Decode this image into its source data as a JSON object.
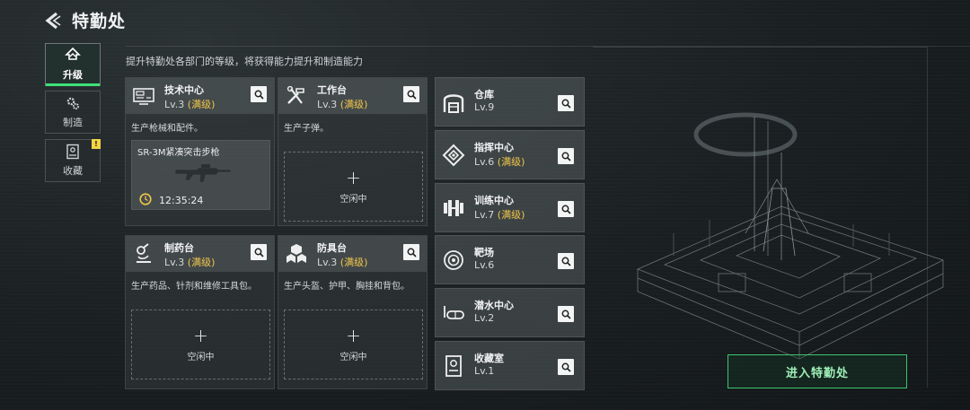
{
  "header": {
    "title": "特勤处"
  },
  "subtitle": "提升特勤处各部门的等级，将获得能力提升和制造能力",
  "sidebar": {
    "tabs": [
      {
        "label": "升级",
        "icon": "upgrade-icon",
        "active": true
      },
      {
        "label": "制造",
        "icon": "gear-icon",
        "active": false
      },
      {
        "label": "收藏",
        "icon": "collection-icon",
        "active": false,
        "badge": "!"
      }
    ]
  },
  "production_cards": [
    {
      "name": "技术中心",
      "level": "Lv.3",
      "max": "(满级)",
      "icon": "computer-icon",
      "desc": "生产枪械和配件。",
      "slot": {
        "status": "producing",
        "item": "SR-3M紧凑突击步枪",
        "time": "12:35:24"
      }
    },
    {
      "name": "工作台",
      "level": "Lv.3",
      "max": "(满级)",
      "icon": "tools-icon",
      "desc": "生产子弹。",
      "slot": {
        "status": "idle",
        "label": "空闲中"
      }
    },
    {
      "name": "制药台",
      "level": "Lv.3",
      "max": "(满级)",
      "icon": "microscope-icon",
      "desc": "生产药品、针剂和维修工具包。",
      "slot": {
        "status": "idle",
        "label": "空闲中"
      }
    },
    {
      "name": "防具台",
      "level": "Lv.3",
      "max": "(满级)",
      "icon": "armor-blocks-icon",
      "desc": "生产头盔、护甲、胸挂和背包。",
      "slot": {
        "status": "idle",
        "label": "空闲中"
      }
    }
  ],
  "facility_cards": [
    {
      "name": "仓库",
      "level": "Lv.9",
      "max": "",
      "icon": "warehouse-icon"
    },
    {
      "name": "指挥中心",
      "level": "Lv.6",
      "max": "(满级)",
      "icon": "command-chip-icon"
    },
    {
      "name": "训练中心",
      "level": "Lv.7",
      "max": "(满级)",
      "icon": "dumbbell-icon"
    },
    {
      "name": "靶场",
      "level": "Lv.6",
      "max": "",
      "icon": "target-icon"
    },
    {
      "name": "潜水中心",
      "level": "Lv.2",
      "max": "",
      "icon": "diving-mask-icon"
    },
    {
      "name": "收藏室",
      "level": "Lv.1",
      "max": "",
      "icon": "display-case-icon"
    }
  ],
  "enter_button": "进入特勤处",
  "colors": {
    "accent_green": "#3ee07a",
    "max_level": "#f0c64a",
    "badge": "#f2d544"
  }
}
